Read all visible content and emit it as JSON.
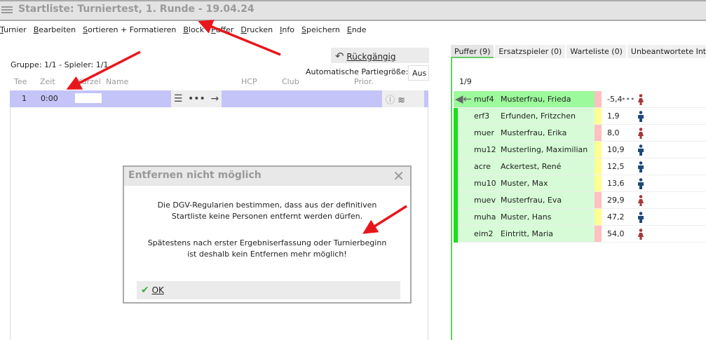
{
  "title": "Startliste: Turniertest, 1. Runde - 19.04.24",
  "menu": [
    "Turnier",
    "Bearbeiten",
    "Sortieren + Formatieren",
    "Block",
    "Puffer",
    "Drucken",
    "Info",
    "Speichern",
    "Ende"
  ],
  "undo_label": "Rückgängig",
  "group_info": "Gruppe: 1/1 - Spieler: 1/1",
  "auto_label": "Automatische Partiegröße:",
  "auto_value": "Aus",
  "columns": [
    "Tee",
    "Zeit",
    "Kürzel",
    "Name",
    "HCP",
    "Club",
    "Prior."
  ],
  "flight": {
    "tee": "1",
    "time": "0:00"
  },
  "dialog": {
    "title": "Entfernen nicht möglich",
    "lines": [
      "Die DGV-Regularien bestimmen, dass aus der definitiven",
      "Startliste keine Personen entfernt werden dürfen.",
      "Spätestens nach erster Ergebniserfassung oder Turnierbeginn",
      "ist deshalb kein Entfernen mehr möglich!"
    ],
    "ok": "OK"
  },
  "tabs": [
    "Puffer (9)",
    "Ersatzspieler (0)",
    "Warteliste (0)",
    "Unbeantwortete Intranet-"
  ],
  "buffer_count": "1/9",
  "players": [
    {
      "code": "muf4",
      "name": "Musterfrau, Frieda",
      "hcp": "-5,4",
      "g": "f"
    },
    {
      "code": "erf3",
      "name": "Erfunden, Fritzchen",
      "hcp": "1,9",
      "g": "m"
    },
    {
      "code": "muer",
      "name": "Musterfrau, Erika",
      "hcp": "8,0",
      "g": "f"
    },
    {
      "code": "mu12",
      "name": "Musterling, Maximilian",
      "hcp": "10,9",
      "g": "m"
    },
    {
      "code": "acre",
      "name": "Ackertest, René",
      "hcp": "12,5",
      "g": "m"
    },
    {
      "code": "mu10",
      "name": "Muster, Max",
      "hcp": "13,6",
      "g": "m"
    },
    {
      "code": "muev",
      "name": "Musterfrau, Eva",
      "hcp": "29,9",
      "g": "f"
    },
    {
      "code": "muha",
      "name": "Muster, Hans",
      "hcp": "47,2",
      "g": "m"
    },
    {
      "code": "eim2",
      "name": "Eintritt, Maria",
      "hcp": "54,0",
      "g": "f"
    }
  ],
  "colors": {
    "female": "#a33a3a",
    "male": "#1f4a7a",
    "strip_f": "#ffc0c0",
    "strip_m": "#ffff90"
  }
}
